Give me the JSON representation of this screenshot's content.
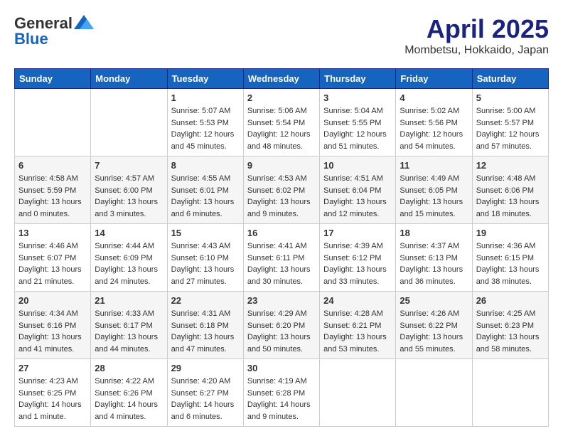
{
  "header": {
    "logo_general": "General",
    "logo_blue": "Blue",
    "month_title": "April 2025",
    "location": "Mombetsu, Hokkaido, Japan"
  },
  "calendar": {
    "weekdays": [
      "Sunday",
      "Monday",
      "Tuesday",
      "Wednesday",
      "Thursday",
      "Friday",
      "Saturday"
    ],
    "weeks": [
      [
        {
          "day": "",
          "info": ""
        },
        {
          "day": "",
          "info": ""
        },
        {
          "day": "1",
          "info": "Sunrise: 5:07 AM\nSunset: 5:53 PM\nDaylight: 12 hours and 45 minutes."
        },
        {
          "day": "2",
          "info": "Sunrise: 5:06 AM\nSunset: 5:54 PM\nDaylight: 12 hours and 48 minutes."
        },
        {
          "day": "3",
          "info": "Sunrise: 5:04 AM\nSunset: 5:55 PM\nDaylight: 12 hours and 51 minutes."
        },
        {
          "day": "4",
          "info": "Sunrise: 5:02 AM\nSunset: 5:56 PM\nDaylight: 12 hours and 54 minutes."
        },
        {
          "day": "5",
          "info": "Sunrise: 5:00 AM\nSunset: 5:57 PM\nDaylight: 12 hours and 57 minutes."
        }
      ],
      [
        {
          "day": "6",
          "info": "Sunrise: 4:58 AM\nSunset: 5:59 PM\nDaylight: 13 hours and 0 minutes."
        },
        {
          "day": "7",
          "info": "Sunrise: 4:57 AM\nSunset: 6:00 PM\nDaylight: 13 hours and 3 minutes."
        },
        {
          "day": "8",
          "info": "Sunrise: 4:55 AM\nSunset: 6:01 PM\nDaylight: 13 hours and 6 minutes."
        },
        {
          "day": "9",
          "info": "Sunrise: 4:53 AM\nSunset: 6:02 PM\nDaylight: 13 hours and 9 minutes."
        },
        {
          "day": "10",
          "info": "Sunrise: 4:51 AM\nSunset: 6:04 PM\nDaylight: 13 hours and 12 minutes."
        },
        {
          "day": "11",
          "info": "Sunrise: 4:49 AM\nSunset: 6:05 PM\nDaylight: 13 hours and 15 minutes."
        },
        {
          "day": "12",
          "info": "Sunrise: 4:48 AM\nSunset: 6:06 PM\nDaylight: 13 hours and 18 minutes."
        }
      ],
      [
        {
          "day": "13",
          "info": "Sunrise: 4:46 AM\nSunset: 6:07 PM\nDaylight: 13 hours and 21 minutes."
        },
        {
          "day": "14",
          "info": "Sunrise: 4:44 AM\nSunset: 6:09 PM\nDaylight: 13 hours and 24 minutes."
        },
        {
          "day": "15",
          "info": "Sunrise: 4:43 AM\nSunset: 6:10 PM\nDaylight: 13 hours and 27 minutes."
        },
        {
          "day": "16",
          "info": "Sunrise: 4:41 AM\nSunset: 6:11 PM\nDaylight: 13 hours and 30 minutes."
        },
        {
          "day": "17",
          "info": "Sunrise: 4:39 AM\nSunset: 6:12 PM\nDaylight: 13 hours and 33 minutes."
        },
        {
          "day": "18",
          "info": "Sunrise: 4:37 AM\nSunset: 6:13 PM\nDaylight: 13 hours and 36 minutes."
        },
        {
          "day": "19",
          "info": "Sunrise: 4:36 AM\nSunset: 6:15 PM\nDaylight: 13 hours and 38 minutes."
        }
      ],
      [
        {
          "day": "20",
          "info": "Sunrise: 4:34 AM\nSunset: 6:16 PM\nDaylight: 13 hours and 41 minutes."
        },
        {
          "day": "21",
          "info": "Sunrise: 4:33 AM\nSunset: 6:17 PM\nDaylight: 13 hours and 44 minutes."
        },
        {
          "day": "22",
          "info": "Sunrise: 4:31 AM\nSunset: 6:18 PM\nDaylight: 13 hours and 47 minutes."
        },
        {
          "day": "23",
          "info": "Sunrise: 4:29 AM\nSunset: 6:20 PM\nDaylight: 13 hours and 50 minutes."
        },
        {
          "day": "24",
          "info": "Sunrise: 4:28 AM\nSunset: 6:21 PM\nDaylight: 13 hours and 53 minutes."
        },
        {
          "day": "25",
          "info": "Sunrise: 4:26 AM\nSunset: 6:22 PM\nDaylight: 13 hours and 55 minutes."
        },
        {
          "day": "26",
          "info": "Sunrise: 4:25 AM\nSunset: 6:23 PM\nDaylight: 13 hours and 58 minutes."
        }
      ],
      [
        {
          "day": "27",
          "info": "Sunrise: 4:23 AM\nSunset: 6:25 PM\nDaylight: 14 hours and 1 minute."
        },
        {
          "day": "28",
          "info": "Sunrise: 4:22 AM\nSunset: 6:26 PM\nDaylight: 14 hours and 4 minutes."
        },
        {
          "day": "29",
          "info": "Sunrise: 4:20 AM\nSunset: 6:27 PM\nDaylight: 14 hours and 6 minutes."
        },
        {
          "day": "30",
          "info": "Sunrise: 4:19 AM\nSunset: 6:28 PM\nDaylight: 14 hours and 9 minutes."
        },
        {
          "day": "",
          "info": ""
        },
        {
          "day": "",
          "info": ""
        },
        {
          "day": "",
          "info": ""
        }
      ]
    ]
  }
}
